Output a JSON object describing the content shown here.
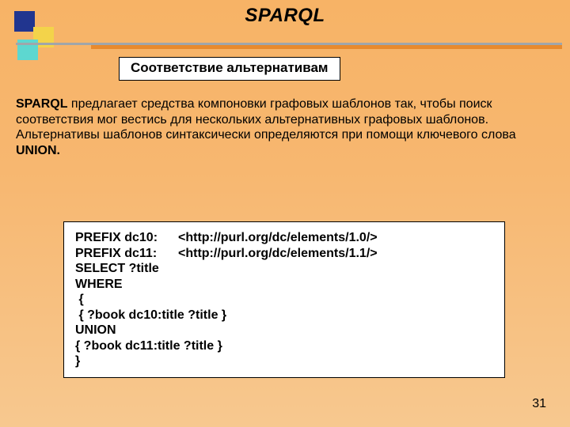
{
  "header": {
    "title": "SPARQL",
    "subtitle": "Соответствие альтернативам"
  },
  "body": {
    "line1_strong": "SPARQL",
    "line1_rest": " предлагает средства компоновки графовых шаблонов так, чтобы поиск соответствия мог вестись для нескольких альтернативных графовых шаблонов.",
    "line2_pre": "Альтернативы шаблонов синтаксически определяются при помощи ключевого слова ",
    "line2_strong": "UNION.",
    "line2_post": ""
  },
  "code": {
    "prefix1_label": "PREFIX dc10:",
    "prefix1_val": "<http://purl.org/dc/elements/1.0/>",
    "prefix2_label": "PREFIX dc11:",
    "prefix2_val": "<http://purl.org/dc/elements/1.1/>",
    "l3": "SELECT ?title",
    "l4": "WHERE",
    "l5": " {",
    "l6": " { ?book dc10:title ?title }",
    "l7": "UNION",
    "l8": "{ ?book dc11:title ?title }",
    "l9": "}"
  },
  "page": "31"
}
